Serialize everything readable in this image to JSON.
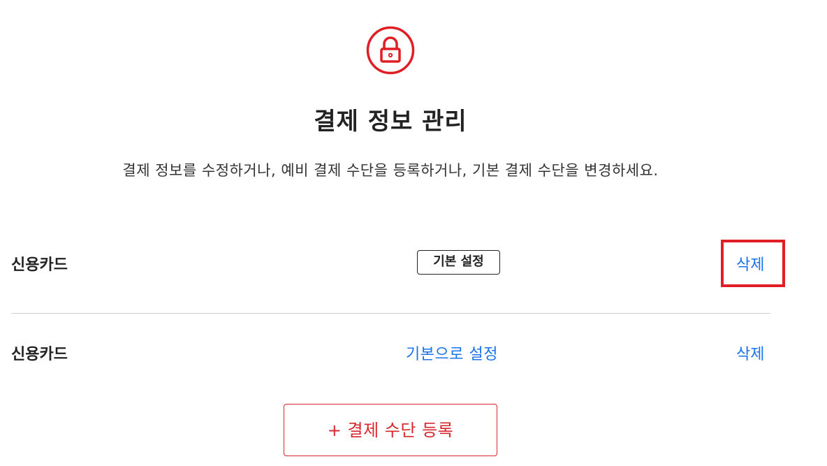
{
  "header": {
    "icon": "lock-icon",
    "accent_color": "#e01e26",
    "title": "결제 정보 관리",
    "description": "결제 정보를 수정하거나, 예비 결제 수단을 등록하거나, 기본 결제 수단을 변경하세요."
  },
  "payment_methods": [
    {
      "label": "신용카드",
      "is_default": true,
      "default_badge": "기본 설정",
      "delete_label": "삭제"
    },
    {
      "label": "신용카드",
      "is_default": false,
      "set_default_label": "기본으로 설정",
      "delete_label": "삭제"
    }
  ],
  "add_button": {
    "label": "+ 결제 수단 등록"
  },
  "colors": {
    "link": "#1a73e8",
    "brand_red": "#d7262d",
    "text": "#222222"
  }
}
